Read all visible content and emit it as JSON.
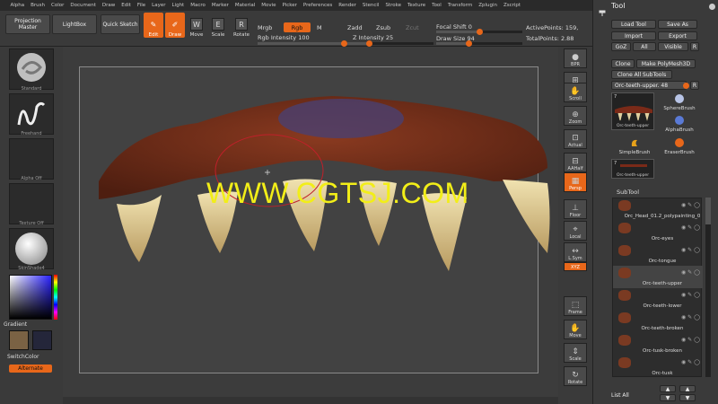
{
  "menu": [
    "Alpha",
    "Brush",
    "Color",
    "Document",
    "Draw",
    "Edit",
    "File",
    "Layer",
    "Light",
    "Macro",
    "Marker",
    "Material",
    "Movie",
    "Picker",
    "Preferences",
    "Render",
    "Stencil",
    "Stroke",
    "Texture",
    "Tool",
    "Transform",
    "Zplugin",
    "Zscript"
  ],
  "toolbar": {
    "projection_master": "Projection Master",
    "lightbox": "LightBox",
    "quick_sketch": "Quick Sketch",
    "edit": "Edit",
    "draw": "Draw",
    "move": "Move",
    "scale": "Scale",
    "rotate": "Rotate",
    "mrgb": "Mrgb",
    "rgb": "Rgb",
    "m": "M",
    "rgb_intensity": "Rgb Intensity 100",
    "zadd": "Zadd",
    "zsub": "Zsub",
    "zcut": "Zcut",
    "z_intensity": "Z Intensity 25",
    "focal_shift": "Focal Shift 0",
    "draw_size": "Draw Size 94",
    "active_points": "ActivePoints: 159,",
    "total_points": "TotalPoints: 2.88",
    "rgb_intensity_level": 1.0,
    "z_intensity_level": 0.25,
    "focal_shift_level": 0.5,
    "draw_size_level": 0.37
  },
  "left": {
    "standard": "Standard",
    "freehand": "Freehand",
    "alpha_off": "Alpha Off",
    "texture_off": "Texture Off",
    "skinshade": "SkinShade4",
    "gradient": "Gradient",
    "switchcolor": "SwitchColor",
    "alternate": "Alternate"
  },
  "canvas": {
    "watermark": "WWW.CGTSJ.COM"
  },
  "right_shelf": [
    "BPR",
    "SPix",
    "Scroll",
    "Zoom",
    "Actual",
    "AAHalf",
    "Persp",
    "Floor",
    "Local",
    "L.Sym",
    "XYZ",
    "Frame",
    "Move",
    "Scale",
    "Rotate"
  ],
  "tool": {
    "title": "Tool",
    "load_tool": "Load Tool",
    "save_as": "Save As",
    "import": "Import",
    "export": "Export",
    "goz": "GoZ",
    "all": "All",
    "visible": "Visible",
    "r": "R",
    "clone": "Clone",
    "make_polymesh": "Make PolyMesh3D",
    "clone_all_subtools": "Clone All SubTools",
    "current_tool": "Orc-teeth-upper. 48",
    "current_tool_label": "Orc-teeth-upper",
    "sphere_brush": "SphereBrush",
    "alpha_brush": "AlphaBrush",
    "simple_brush": "SimpleBrush",
    "eraser_brush": "EraserBrush",
    "thumb_count": "7",
    "thumb_count_2": "7",
    "orc_teeth_upper_2": "Orc-teeth-upper",
    "subtool_title": "SubTool",
    "subtools": [
      "Orc_Head_01.2_polypainting_0",
      "Orc-eyes",
      "Orc-tongue",
      "Orc-teeth-upper",
      "Orc-teeth-lower",
      "Orc-teeth-broken",
      "Orc-tusk-broken",
      "Orc-tusk"
    ],
    "list_all": "List All"
  },
  "colors": {
    "accent": "#e8671a",
    "watermark": "#f2ee18"
  }
}
